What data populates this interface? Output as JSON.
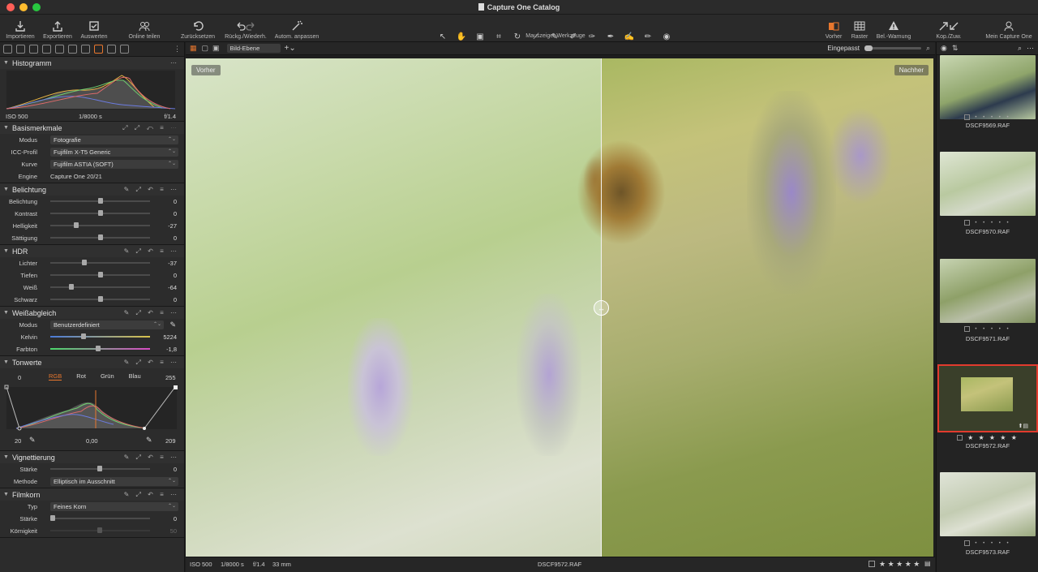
{
  "window": {
    "title": "Capture One Catalog"
  },
  "toolbar": {
    "import": "Importieren",
    "export": "Exportieren",
    "select": "Auswerten",
    "online": "Online teilen",
    "reset": "Zurücksetzen",
    "undo": "Rückg./Wiederh.",
    "auto": "Autom. anpassen",
    "cursor_tools": "Mauszeiger Werkzeuge",
    "before": "Vorher",
    "grid": "Raster",
    "warning": "Bel.-Warnung",
    "copy": "Kop./Zuw.",
    "account": "Mein Capture One"
  },
  "histogram": {
    "title": "Histogramm",
    "iso": "ISO 500",
    "shutter": "1/8000 s",
    "aperture": "f/1.4"
  },
  "basic": {
    "title": "Basismerkmale",
    "rows": [
      {
        "label": "Modus",
        "value": "Fotografie"
      },
      {
        "label": "ICC-Profil",
        "value": "Fujifilm X-T5 Generic"
      },
      {
        "label": "Kurve",
        "value": "Fujifilm ASTIA (SOFT)"
      },
      {
        "label": "Engine",
        "value": "Capture One 20/21"
      }
    ]
  },
  "exposure": {
    "title": "Belichtung",
    "rows": [
      {
        "label": "Belichtung",
        "value": "0",
        "level": 0.5
      },
      {
        "label": "Kontrast",
        "value": "0",
        "level": 0.5
      },
      {
        "label": "Helligkeit",
        "value": "-27",
        "level": 0.25
      },
      {
        "label": "Sättigung",
        "value": "0",
        "level": 0.5
      }
    ]
  },
  "hdr": {
    "title": "HDR",
    "rows": [
      {
        "label": "Lichter",
        "value": "-37",
        "level": 0.33
      },
      {
        "label": "Tiefen",
        "value": "0",
        "level": 0.5
      },
      {
        "label": "Weiß",
        "value": "-64",
        "level": 0.2
      },
      {
        "label": "Schwarz",
        "value": "0",
        "level": 0.5
      }
    ]
  },
  "wb": {
    "title": "Weißabgleich",
    "mode_label": "Modus",
    "mode": "Benutzerdefiniert",
    "kelvin_label": "Kelvin",
    "kelvin": "5224",
    "tint_label": "Farbton",
    "tint": "-1,8"
  },
  "levels": {
    "title": "Tonwerte",
    "low": "0",
    "high": "255",
    "tabs": [
      "RGB",
      "Rot",
      "Grün",
      "Blau"
    ],
    "in_low": "20",
    "mid": "0,00",
    "in_high": "209"
  },
  "vignette": {
    "title": "Vignettierung",
    "amount_label": "Stärke",
    "amount": "0",
    "method_label": "Methode",
    "method": "Elliptisch im Ausschnitt"
  },
  "grain": {
    "title": "Filmkorn",
    "type_label": "Typ",
    "type": "Feines Korn",
    "strength_label": "Stärke",
    "strength": "0",
    "rough_label": "Körnigkeit",
    "rough": "50"
  },
  "viewer": {
    "layer": "Bild-Ebene",
    "zoom": "Eingepasst",
    "before_tag": "Vorher",
    "after_tag": "Nachher"
  },
  "status": {
    "iso": "ISO 500",
    "shutter": "1/8000 s",
    "aperture": "f/1.4",
    "focal": "33 mm",
    "filename": "DSCF9572.RAF",
    "stars": "★ ★ ★ ★ ★"
  },
  "filmstrip": [
    {
      "name": "DSCF9569.RAF",
      "stars": "• • • • •"
    },
    {
      "name": "DSCF9570.RAF",
      "stars": "• • • • •"
    },
    {
      "name": "DSCF9571.RAF",
      "stars": "• • • • •"
    },
    {
      "name": "DSCF9572.RAF",
      "stars": "★ ★ ★ ★ ★"
    },
    {
      "name": "DSCF9573.RAF",
      "stars": "• • • • •"
    }
  ],
  "colors": {
    "accent": "#e8772e",
    "selected": "#e23b2e"
  }
}
